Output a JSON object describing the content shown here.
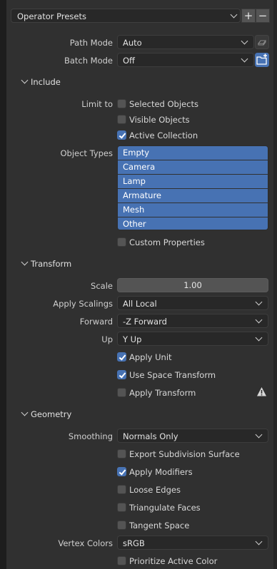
{
  "preset_bar": {
    "label": "Operator Presets",
    "add": "+",
    "remove": "−"
  },
  "path_mode": {
    "label": "Path Mode",
    "value": "Auto"
  },
  "batch_mode": {
    "label": "Batch Mode",
    "value": "Off"
  },
  "include": {
    "title": "Include",
    "limit_to_label": "Limit to",
    "limit_options": [
      {
        "label": "Selected Objects",
        "checked": false
      },
      {
        "label": "Visible Objects",
        "checked": false
      },
      {
        "label": "Active Collection",
        "checked": true
      }
    ],
    "object_types_label": "Object Types",
    "object_types": [
      "Empty",
      "Camera",
      "Lamp",
      "Armature",
      "Mesh",
      "Other"
    ],
    "custom_properties": {
      "label": "Custom Properties",
      "checked": false
    }
  },
  "transform": {
    "title": "Transform",
    "scale": {
      "label": "Scale",
      "value": "1.00"
    },
    "apply_scalings": {
      "label": "Apply Scalings",
      "value": "All Local"
    },
    "forward": {
      "label": "Forward",
      "value": "-Z Forward"
    },
    "up": {
      "label": "Up",
      "value": "Y Up"
    },
    "apply_unit": {
      "label": "Apply Unit",
      "checked": true
    },
    "use_space_transform": {
      "label": "Use Space Transform",
      "checked": true
    },
    "apply_transform": {
      "label": "Apply Transform",
      "checked": false
    }
  },
  "geometry": {
    "title": "Geometry",
    "smoothing": {
      "label": "Smoothing",
      "value": "Normals Only"
    },
    "export_subdivision": {
      "label": "Export Subdivision Surface",
      "checked": false
    },
    "apply_modifiers": {
      "label": "Apply Modifiers",
      "checked": true
    },
    "loose_edges": {
      "label": "Loose Edges",
      "checked": false
    },
    "triangulate": {
      "label": "Triangulate Faces",
      "checked": false
    },
    "tangent_space": {
      "label": "Tangent Space",
      "checked": false
    },
    "vertex_colors": {
      "label": "Vertex Colors",
      "value": "sRGB"
    },
    "prioritize_active_color": {
      "label": "Prioritize Active Color",
      "checked": false
    }
  },
  "colors": {
    "accent": "#4772b3",
    "panel": "#303030",
    "field": "#282828"
  }
}
